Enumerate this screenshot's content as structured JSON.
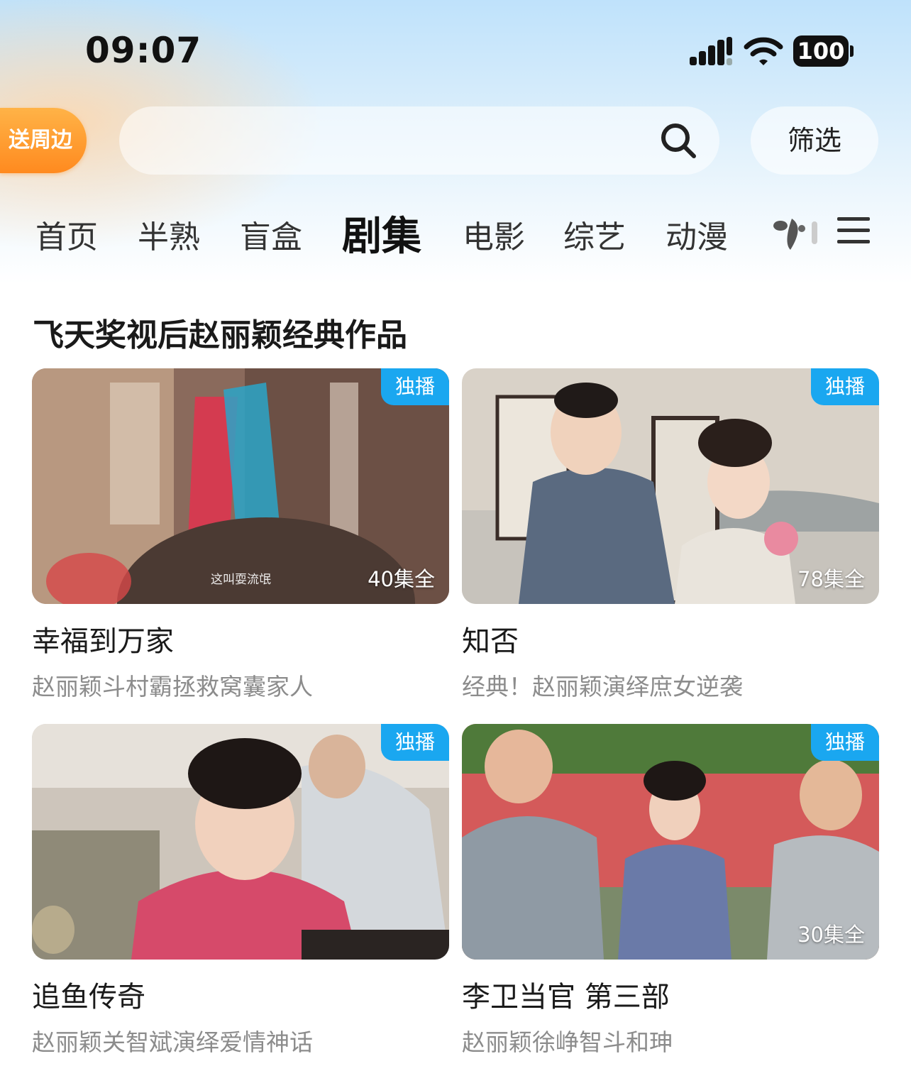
{
  "status_bar": {
    "time": "09:07",
    "battery": "100",
    "icons": [
      "signal-icon",
      "wifi-icon",
      "battery-icon"
    ]
  },
  "header": {
    "gift_badge": "送周边",
    "search_placeholder": "",
    "filter_label": "筛选"
  },
  "nav": {
    "tabs": [
      {
        "label": "首页",
        "active": false
      },
      {
        "label": "半熟",
        "active": false
      },
      {
        "label": "盲盒",
        "active": false
      },
      {
        "label": "剧集",
        "active": true
      },
      {
        "label": "电影",
        "active": false
      },
      {
        "label": "综艺",
        "active": false
      },
      {
        "label": "动漫",
        "active": false
      }
    ]
  },
  "section": {
    "title": "飞天奖视后赵丽颖经典作品",
    "cards": [
      {
        "badge": "独播",
        "episodes": "40集全",
        "caption": "这叫耍流氓",
        "title": "幸福到万家",
        "subtitle": "赵丽颖斗村霸拯救窝囊家人"
      },
      {
        "badge": "独播",
        "episodes": "78集全",
        "title": "知否",
        "subtitle": "经典！赵丽颖演绎庶女逆袭"
      },
      {
        "badge": "独播",
        "episodes": "",
        "title": "追鱼传奇",
        "subtitle": "赵丽颖关智斌演绎爱情神话"
      },
      {
        "badge": "独播",
        "episodes": "30集全",
        "title": "李卫当官 第三部",
        "subtitle": "赵丽颖徐峥智斗和珅"
      }
    ]
  },
  "colors": {
    "accent": "#1aa7f0",
    "gift_badge": "#ff8a1f",
    "subtitle_gray": "#8c8c8c"
  }
}
